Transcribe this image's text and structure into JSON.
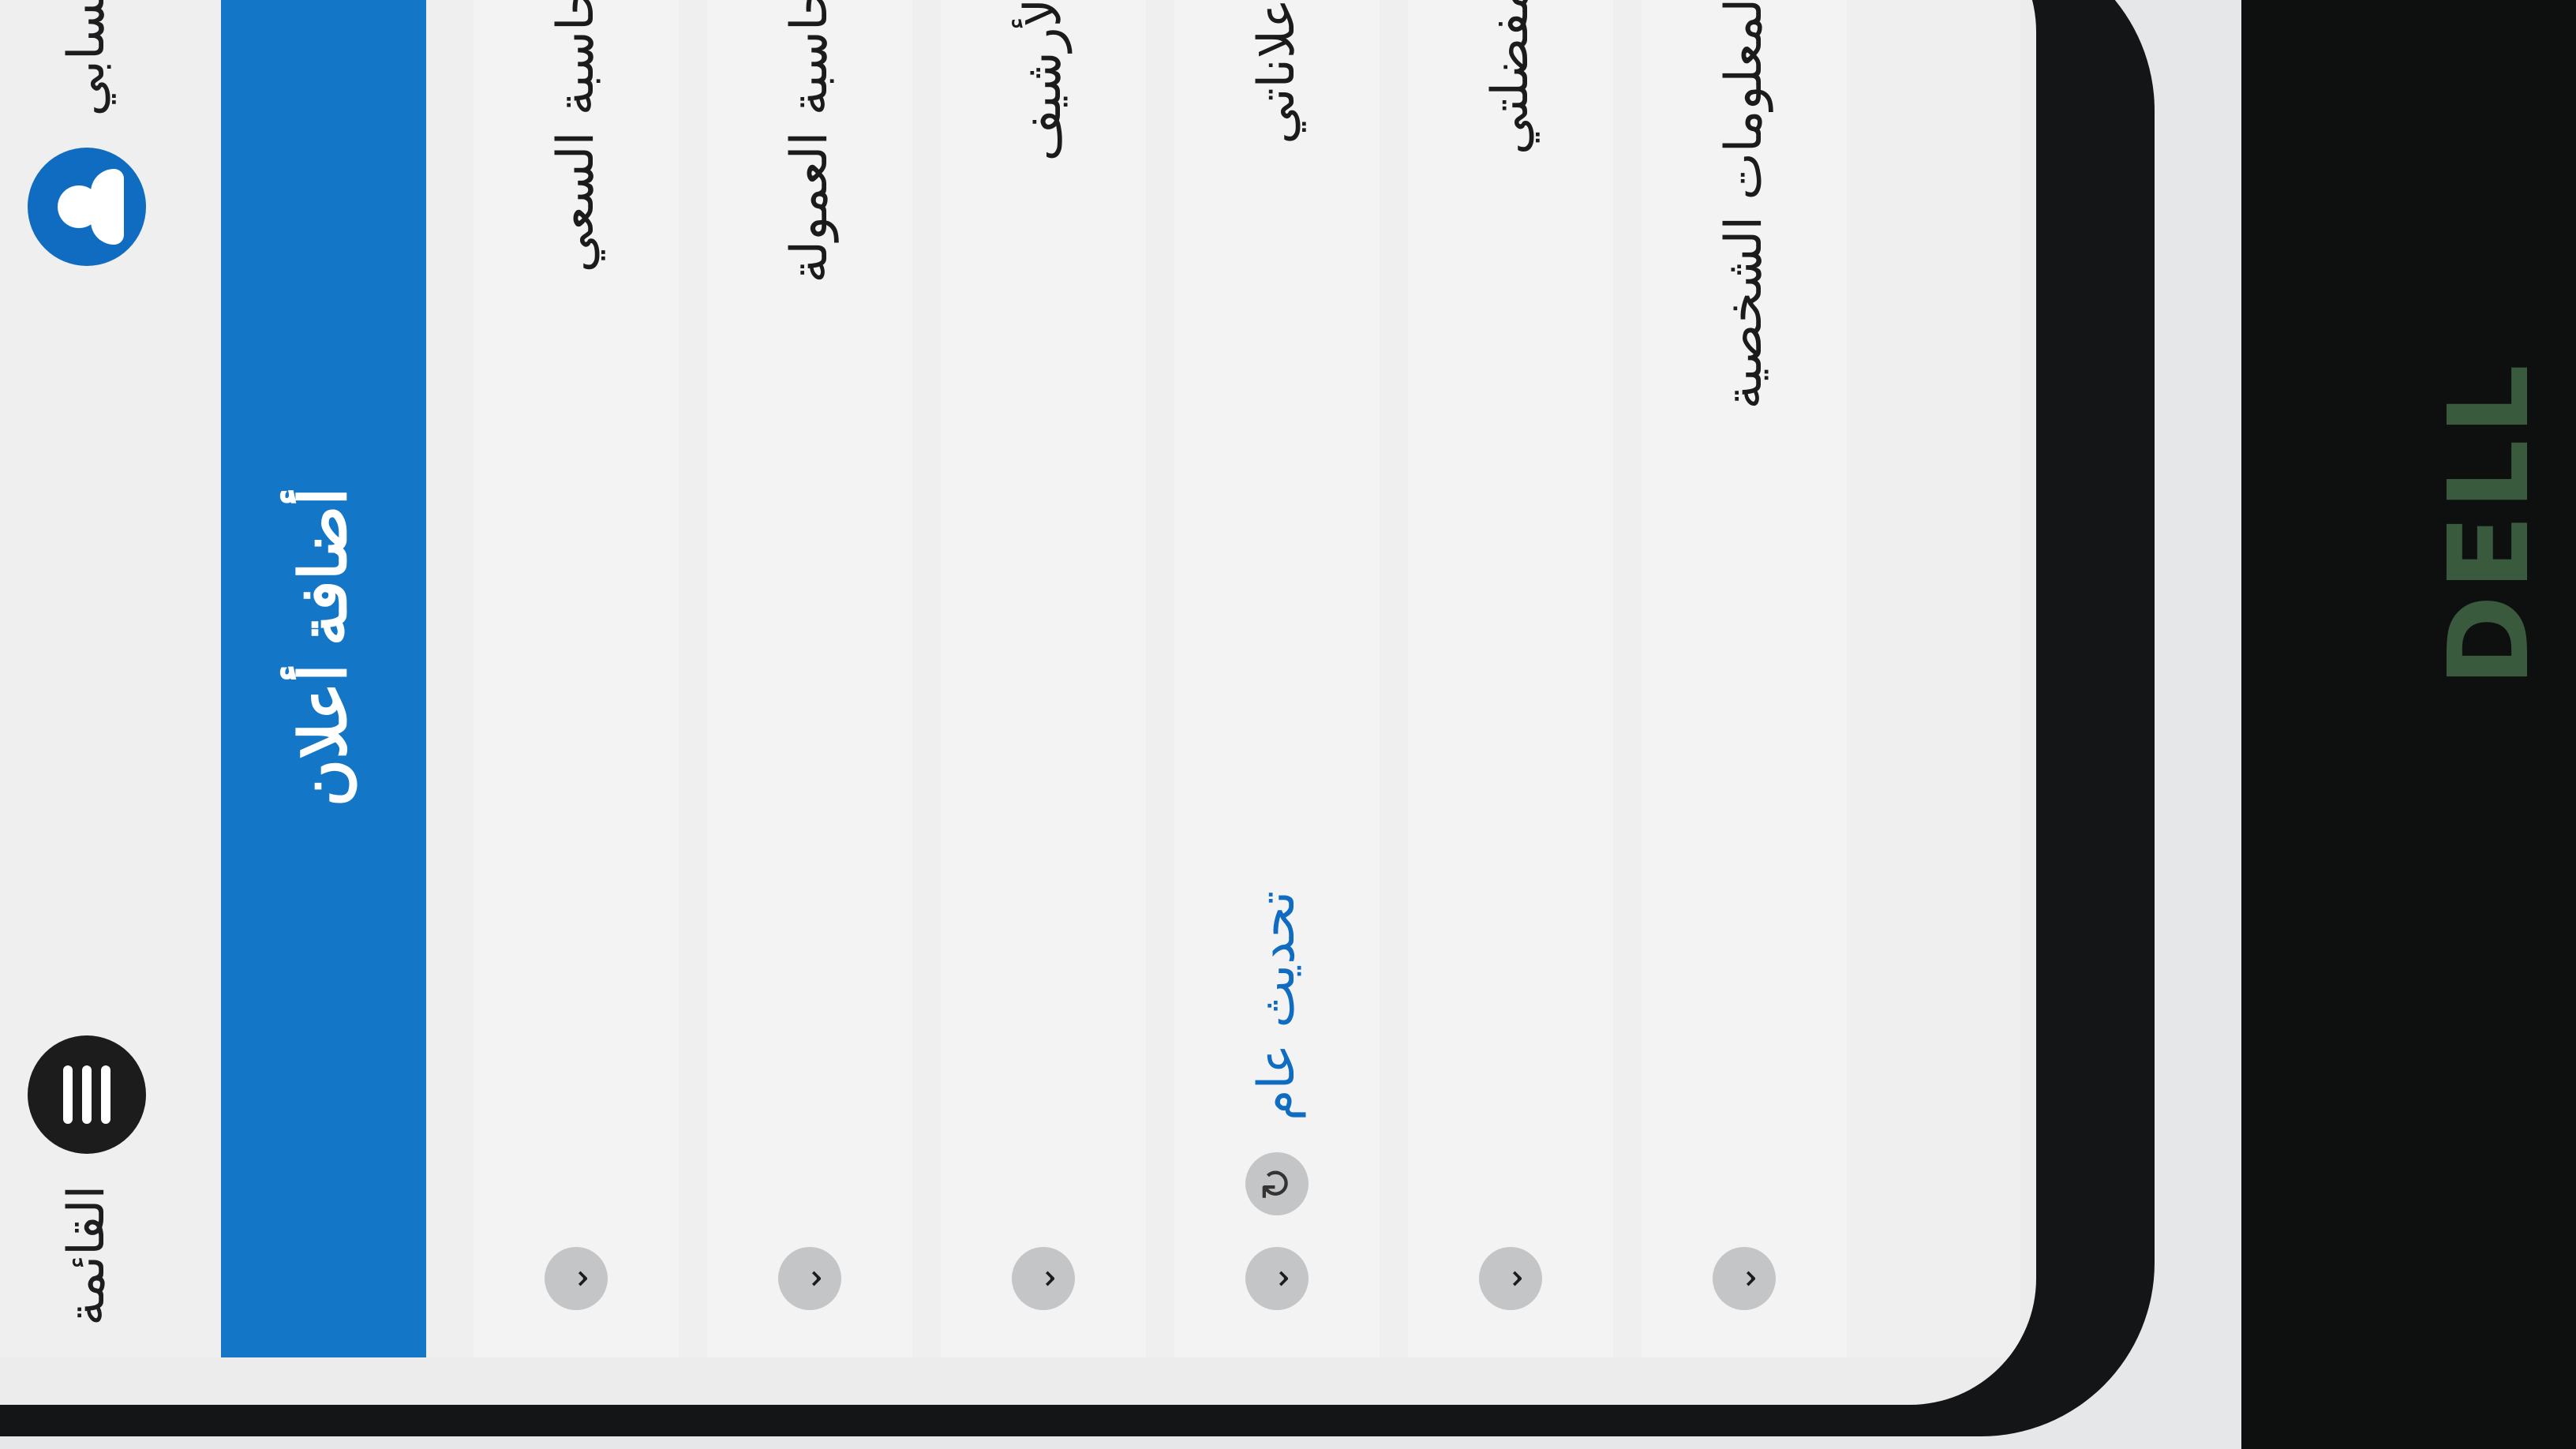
{
  "device": {
    "brand_logo": "DELL"
  },
  "header": {
    "account_label": "حسابي",
    "menu_label": "القائمة"
  },
  "actions": {
    "add_listing": "أضافة أعلان"
  },
  "menu": {
    "items": [
      {
        "label": "حاسبة السعي"
      },
      {
        "label": "حاسبة العمولة"
      },
      {
        "label": "الأرشيف"
      },
      {
        "label": "أعلاناتي",
        "sublabel": "تحديث عام"
      },
      {
        "label": "مفضلتي"
      },
      {
        "label": "المعلومات الشخصية"
      }
    ]
  },
  "icons": {
    "account": "account-icon",
    "menu": "menu-icon",
    "chevron": "chevron-down-icon",
    "refresh": "refresh-icon"
  },
  "colors": {
    "accent": "#1376c6",
    "background": "#efeff0",
    "text": "#1b1b1c"
  }
}
